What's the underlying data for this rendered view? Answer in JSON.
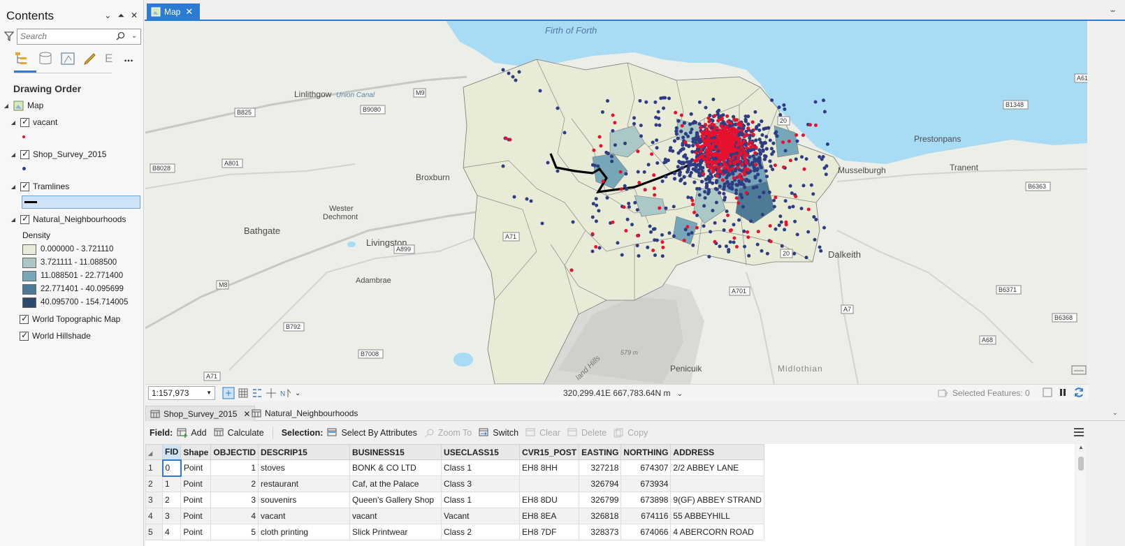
{
  "contents": {
    "title": "Contents",
    "search_placeholder": "Search",
    "drawing_order": "Drawing Order",
    "tool_e": "E",
    "tool_more": "...",
    "layers": {
      "map": "Map",
      "vacant": "vacant",
      "shop_survey": "Shop_Survey_2015",
      "tramlines": "Tramlines",
      "natural": "Natural_Neighbourhoods",
      "world_topo": "World Topographic Map",
      "world_hill": "World Hillshade"
    },
    "density_title": "Density",
    "density_classes": [
      {
        "label": "0.000000 - 3.721110",
        "color": "#e8ebd5"
      },
      {
        "label": "3.721111 - 11.088500",
        "color": "#a9c8c6"
      },
      {
        "label": "11.088501 - 22.771400",
        "color": "#76a7b8"
      },
      {
        "label": "22.771401 - 40.095699",
        "color": "#4c7a97"
      },
      {
        "label": "40.095700 - 154.714005",
        "color": "#2d4a6e"
      }
    ]
  },
  "map": {
    "tab_label": "Map",
    "place_labels": {
      "firth": "Firth of Forth",
      "linlithgow": "Linlithgow",
      "union_canal": "Union Canal",
      "broxburn": "Broxburn",
      "wester": "Wester",
      "dechmont": "Dechmont",
      "bathgate": "Bathgate",
      "livingston": "Livingston",
      "adambrae": "Adambrae",
      "prestonpans": "Prestonpans",
      "musselburgh": "Musselburgh",
      "tranent": "Tranent",
      "dalkeith": "Dalkeith",
      "penicuik": "Penicuik",
      "midlothian": "Midlothian",
      "pentland": "land Hills",
      "height": "579 m"
    },
    "road_labels": {
      "m9": "M9",
      "b825": "B825",
      "b9080": "B9080",
      "a801": "A801",
      "b8028": "B8028",
      "a899": "A899",
      "a71": "A71",
      "a71b": "A71",
      "m8": "M8",
      "b792": "B792",
      "b7008": "B7008",
      "a701": "A701",
      "a7": "A7",
      "a68": "A68",
      "b1348": "B1348",
      "b6363": "B6363",
      "b6371": "B6371",
      "b6368": "B6368",
      "a61": "A61",
      "num20a": "20",
      "num20b": "20"
    },
    "scale": "1:157,973",
    "coordinates": "320,299.41E 667,783.64N m",
    "selected_features": "Selected Features: 0"
  },
  "table": {
    "tabs": [
      "Shop_Survey_2015",
      "Natural_Neighbourhoods"
    ],
    "toolbar": {
      "field": "Field:",
      "add": "Add",
      "calculate": "Calculate",
      "selection": "Selection:",
      "select_by_attributes": "Select By Attributes",
      "zoom_to": "Zoom To",
      "switch": "Switch",
      "clear": "Clear",
      "delete": "Delete",
      "copy": "Copy"
    },
    "columns": [
      "FID",
      "Shape",
      "OBJECTID",
      "DESCRIP15",
      "BUSINESS15",
      "USECLASS15",
      "CVR15_POST",
      "EASTING",
      "NORTHING",
      "ADDRESS"
    ],
    "rows": [
      {
        "n": "1",
        "fid": "0",
        "shape": "Point",
        "objectid": "1",
        "descrip": "stoves",
        "business": "BONK & CO LTD",
        "useclass": "Class 1",
        "post": "EH8 8HH",
        "easting": "327218",
        "northing": "674307",
        "address": "2/2 ABBEY LANE"
      },
      {
        "n": "2",
        "fid": "1",
        "shape": "Point",
        "objectid": "2",
        "descrip": "restaurant",
        "business": "Caf, at the Palace",
        "useclass": "Class 3",
        "post": "",
        "easting": "326794",
        "northing": "673934",
        "address": ""
      },
      {
        "n": "3",
        "fid": "2",
        "shape": "Point",
        "objectid": "3",
        "descrip": "souvenirs",
        "business": "Queen's Gallery Shop",
        "useclass": "Class 1",
        "post": "EH8 8DU",
        "easting": "326799",
        "northing": "673898",
        "address": "9(GF) ABBEY STRAND"
      },
      {
        "n": "4",
        "fid": "3",
        "shape": "Point",
        "objectid": "4",
        "descrip": "vacant",
        "business": "vacant",
        "useclass": "Vacant",
        "post": "EH8 8EA",
        "easting": "326818",
        "northing": "674116",
        "address": "55 ABBEYHILL"
      },
      {
        "n": "5",
        "fid": "4",
        "shape": "Point",
        "objectid": "5",
        "descrip": "cloth printing",
        "business": "Slick Printwear",
        "useclass": "Class 2",
        "post": "EH8 7DF",
        "easting": "328373",
        "northing": "674066",
        "address": "4 ABERCORN ROAD"
      }
    ]
  },
  "colors": {
    "accent": "#2b7bd1",
    "water": "#a8dcf5",
    "shop_point": "#2e3d83",
    "vacant_point": "#e8112d"
  }
}
